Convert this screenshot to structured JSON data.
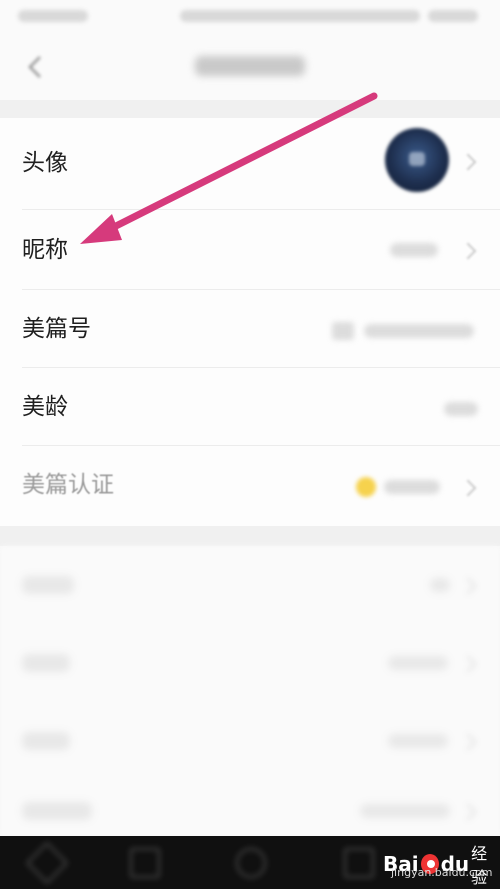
{
  "rows": {
    "avatar": {
      "label": "头像"
    },
    "nickname": {
      "label": "昵称"
    },
    "meipian_id": {
      "label": "美篇号"
    },
    "age": {
      "label": "美龄"
    },
    "certification": {
      "label": "美篇认证"
    }
  },
  "watermark": {
    "logo": "Bai",
    "logo_suffix": "du",
    "text": "经验",
    "sub": "jingyan.baidu.com"
  },
  "colors": {
    "arrow": "#d63a7c",
    "badge": "#f6d24d"
  },
  "icons": [
    "back-icon",
    "chevron-right-icon",
    "avatar-image",
    "badge-icon",
    "arrow-annotation"
  ]
}
